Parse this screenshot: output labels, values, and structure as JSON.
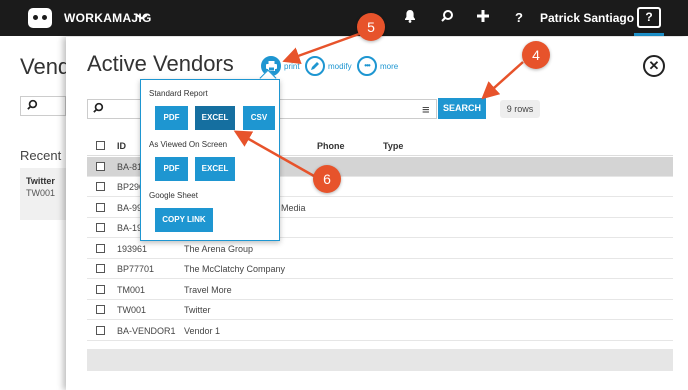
{
  "topbar": {
    "brand": "WORKAMAJIG",
    "brand_caret": "❯",
    "bell_icon": "🔔",
    "search_icon": "⌕",
    "plus_icon": "✚",
    "question_icon": "?",
    "user_name": "Patrick Santiago",
    "help_label": "?"
  },
  "background": {
    "title": "Vend",
    "search_icon": "⌕",
    "recent_label": "Recent",
    "recent_card": {
      "name": "Twitter",
      "id": "TW001"
    }
  },
  "panel": {
    "title": "Active Vendors",
    "actions": [
      {
        "icon": "⎙",
        "label": "print"
      },
      {
        "icon": "✎",
        "label": "modify"
      },
      {
        "icon": "•••",
        "label": "more"
      }
    ],
    "close_icon": "✕",
    "search": {
      "icon": "⌕",
      "value": "",
      "menu_icon": "≡",
      "button": "SEARCH",
      "row_count": "9 rows"
    },
    "table": {
      "headers": {
        "id": "ID",
        "phone": "Phone",
        "type": "Type"
      },
      "rows": [
        {
          "id": "BA-81",
          "name": ""
        },
        {
          "id": "BP290",
          "name": ""
        },
        {
          "id": "BA-99",
          "name": "Media"
        },
        {
          "id": "BA-19",
          "name": ""
        },
        {
          "id": "193961",
          "name": "The Arena Group"
        },
        {
          "id": "BP77701",
          "name": "The McClatchy Company"
        },
        {
          "id": "TM001",
          "name": "Travel More"
        },
        {
          "id": "TW001",
          "name": "Twitter"
        },
        {
          "id": "BA-VENDOR1",
          "name": "Vendor 1"
        }
      ]
    }
  },
  "popover": {
    "standard_report": "Standard Report",
    "pdf": "PDF",
    "excel": "EXCEL",
    "csv": "CSV",
    "as_viewed": "As Viewed On Screen",
    "pdf2": "PDF",
    "excel2": "EXCEL",
    "google_sheet": "Google Sheet",
    "copy_link": "COPY LINK"
  },
  "annotations": [
    "5",
    "4",
    "6"
  ],
  "colors": {
    "accent": "#1e96d1",
    "annotation": "#e7532b",
    "topbar": "#1b1b1b"
  }
}
